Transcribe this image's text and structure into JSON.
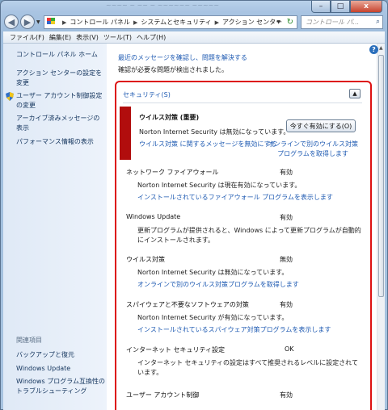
{
  "titlebar": {
    "ghost_text": "~~~~ ~ ~~ ~ ~~~~~~ ~~~~~",
    "minimize": "–",
    "maximize": "□",
    "close": "x"
  },
  "nav": {
    "breadcrumb": [
      "コントロール パネル",
      "システムとセキュリティ",
      "アクション センター"
    ],
    "search_placeholder": "コントロール パ..."
  },
  "menu": [
    "ファイル(F)",
    "編集(E)",
    "表示(V)",
    "ツール(T)",
    "ヘルプ(H)"
  ],
  "sidebar": {
    "home": "コントロール パネル ホーム",
    "links": [
      "アクション センターの設定を変更",
      "ユーザー アカウント制御設定の変更",
      "アーカイブ済みメッセージの表示",
      "パフォーマンス情報の表示"
    ],
    "related_title": "関連項目",
    "related": [
      "バックアップと復元",
      "Windows Update",
      "Windows プログラム互換性のトラブルシューティング"
    ]
  },
  "main": {
    "intro_link": "最近のメッセージを確認し、問題を解決する",
    "intro_text": "確認が必要な問題が検出されました。",
    "section_title": "セキュリティ(S)",
    "alert": {
      "title": "ウイルス対策 (重要)",
      "text": "Norton Internet Security は無効になっています。",
      "button": "今すぐ有効にする(O)",
      "link1": "ウイルス対策 に関するメッセージを無効にする",
      "link2": "オンラインで別のウイルス対策プログラムを取得します"
    },
    "items": [
      {
        "name": "ネットワーク ファイアウォール",
        "status": "有効",
        "desc": "Norton Internet Security は現在有効になっています。",
        "link": "インストールされているファイアウォール プログラムを表示します"
      },
      {
        "name": "Windows Update",
        "status": "有効",
        "desc": "更新プログラムが提供されると、Windows によって更新プログラムが自動的にインストールされます。",
        "link": ""
      },
      {
        "name": "ウイルス対策",
        "status": "無効",
        "desc": "Norton Internet Security は無効になっています。",
        "link": "オンラインで別のウイルス対策プログラムを取得します"
      },
      {
        "name": "スパイウェアと不要なソフトウェアの対策",
        "status": "有効",
        "desc": "Norton Internet Security が有効になっています。",
        "link": "インストールされているスパイウェア対策プログラムを表示します"
      },
      {
        "name": "インターネット セキュリティ設定",
        "status": "OK",
        "desc": "インターネット セキュリティの設定はすべて推奨されるレベルに設定されています。",
        "link": ""
      },
      {
        "name": "ユーザー アカウント制御",
        "status": "有効",
        "desc": "",
        "link": ""
      }
    ]
  },
  "colors": {
    "link": "#1e5ab2",
    "highlight_border": "#dd1111",
    "alert_bar": "#b10d0d"
  }
}
